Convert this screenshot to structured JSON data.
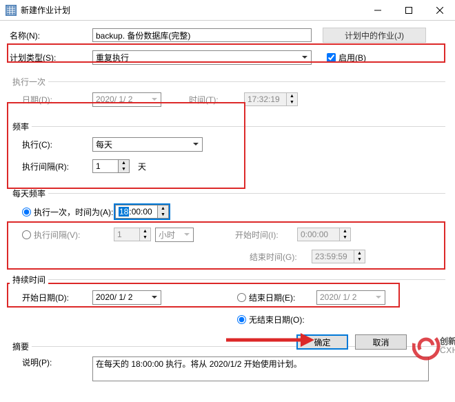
{
  "titlebar": {
    "title": "新建作业计划"
  },
  "name_row": {
    "label": "名称(N):",
    "value": "backup. 备份数据库(完整)",
    "plan_btn": "计划中的作业(J)"
  },
  "type_row": {
    "label": "计划类型(S):",
    "value": "重复执行",
    "enable_label": "启用(B)"
  },
  "once": {
    "legend": "执行一次",
    "date_label": "日期(D):",
    "date_value": "2020/ 1/ 2",
    "time_label": "时间(T):",
    "time_value": "17:32:19"
  },
  "freq": {
    "legend": "频率",
    "exec_label": "执行(C):",
    "exec_value": "每天",
    "interval_label": "执行间隔(R):",
    "interval_value": "1",
    "interval_unit": "天"
  },
  "daily": {
    "legend": "每天频率",
    "once_label": "执行一次，时间为(A):",
    "once_time_prefix": "18",
    "once_time_rest": ":00:00",
    "interval_label": "执行间隔(V):",
    "interval_value": "1",
    "interval_unit": "小时",
    "start_label": "开始时间(I):",
    "start_value": "0:00:00",
    "end_label": "结束时间(G):",
    "end_value": "23:59:59"
  },
  "duration": {
    "legend": "持续时间",
    "start_label": "开始日期(D):",
    "start_value": "2020/ 1/ 2",
    "end_radio_label": "结束日期(E):",
    "end_value": "2020/ 1/ 2",
    "noend_label": "无结束日期(O):"
  },
  "summary": {
    "legend": "摘要",
    "desc_label": "说明(P):",
    "desc_value": "在每天的 18:00:00 执行。将从 2020/1/2 开始使用计划。"
  },
  "buttons": {
    "ok": "确定",
    "cancel": "取消"
  },
  "watermark": {
    "line1": "创新互联",
    "line2": "CXHLCOM"
  }
}
